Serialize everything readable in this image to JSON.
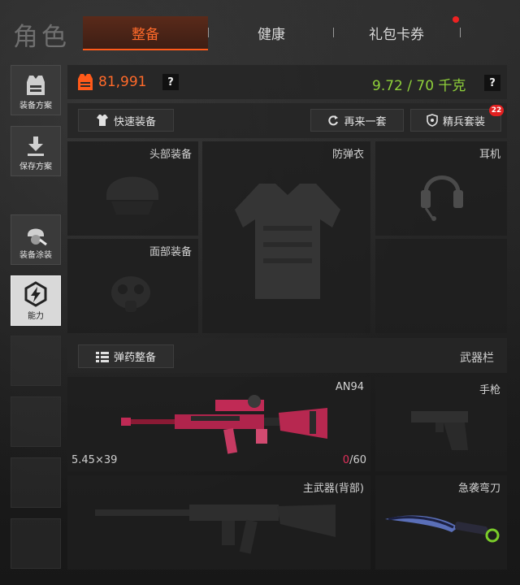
{
  "header": {
    "title": "角色",
    "tabs": [
      {
        "label": "整备",
        "active": true
      },
      {
        "label": "健康",
        "active": false
      },
      {
        "label": "礼包卡券",
        "active": false,
        "has_notification": true
      }
    ]
  },
  "sidebar": {
    "items": [
      {
        "label": "装备方案",
        "icon": "vest-icon"
      },
      {
        "label": "保存方案",
        "icon": "download-icon"
      },
      {
        "label": "装备涂装",
        "icon": "helmet-paint-icon"
      },
      {
        "label": "能力",
        "icon": "lightning-icon",
        "active": true
      }
    ],
    "empty_slots": 4
  },
  "stats": {
    "value": "81,991",
    "help": "?",
    "weight": "9.72 / 70 千克",
    "weight_help": "?"
  },
  "actions": {
    "quick_equip": "快速装备",
    "again": "再来一套",
    "elite": "精兵套装",
    "elite_badge": "22"
  },
  "gear": {
    "head": "头部装备",
    "armor": "防弹衣",
    "earphone": "耳机",
    "face": "面部装备"
  },
  "weapons": {
    "ammo_button": "弹药整备",
    "bar_label": "武器栏",
    "primary": {
      "name": "AN94",
      "caliber": "5.45×39",
      "ammo_current": "0",
      "ammo_max": "/60"
    },
    "pistol": "手枪",
    "secondary": "主武器(背部)",
    "melee": "急袭弯刀"
  },
  "colors": {
    "accent": "#ff5a1a",
    "weight_green": "#8fd13a",
    "ammo_red": "#e0305a",
    "badge_red": "#e22020"
  }
}
